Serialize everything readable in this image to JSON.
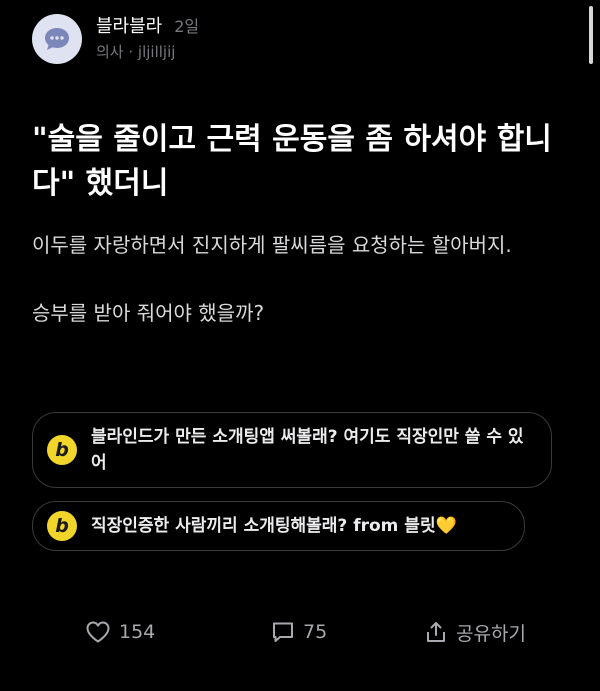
{
  "post": {
    "author": "블라블라",
    "time": "2일",
    "author_meta": "의사 · jljilljij",
    "title": "\"술을 줄이고 근력 운동을 좀 하셔야 합니다\" 했더니",
    "body": [
      "이두를 자랑하면서 진지하게 팔씨름을 요청하는 할아버지.",
      "승부를 받아 줘어야 했을까?"
    ]
  },
  "promos": [
    {
      "badge": "b",
      "text": "블라인드가 만든 소개팅앱 써볼래? 여기도 직장인만 쓸 수 있어"
    },
    {
      "badge": "b",
      "text": "직장인증한 사람끼리 소개팅해볼래? from 블릿💛"
    }
  ],
  "actions": {
    "likes": "154",
    "comments": "75",
    "share_label": "공유하기"
  },
  "colors": {
    "background": "#000000",
    "badge": "#f2d52a",
    "avatar": "#dfe3f1",
    "avatar_icon": "#7b87b8",
    "muted": "#77777d"
  },
  "icons": {
    "avatar": "speech-bubble-icon",
    "like": "heart-icon",
    "comment": "comment-icon",
    "share": "share-icon"
  }
}
